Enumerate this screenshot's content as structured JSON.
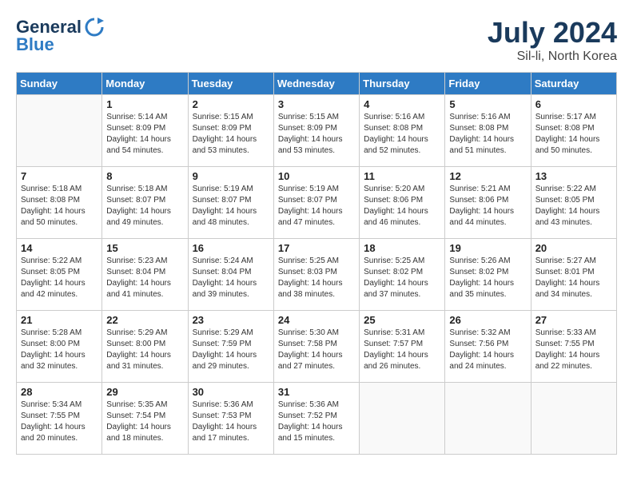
{
  "header": {
    "logo_line1": "General",
    "logo_line2": "Blue",
    "month": "July 2024",
    "location": "Sil-li, North Korea"
  },
  "weekdays": [
    "Sunday",
    "Monday",
    "Tuesday",
    "Wednesday",
    "Thursday",
    "Friday",
    "Saturday"
  ],
  "weeks": [
    [
      {
        "num": "",
        "info": ""
      },
      {
        "num": "1",
        "info": "Sunrise: 5:14 AM\nSunset: 8:09 PM\nDaylight: 14 hours\nand 54 minutes."
      },
      {
        "num": "2",
        "info": "Sunrise: 5:15 AM\nSunset: 8:09 PM\nDaylight: 14 hours\nand 53 minutes."
      },
      {
        "num": "3",
        "info": "Sunrise: 5:15 AM\nSunset: 8:09 PM\nDaylight: 14 hours\nand 53 minutes."
      },
      {
        "num": "4",
        "info": "Sunrise: 5:16 AM\nSunset: 8:08 PM\nDaylight: 14 hours\nand 52 minutes."
      },
      {
        "num": "5",
        "info": "Sunrise: 5:16 AM\nSunset: 8:08 PM\nDaylight: 14 hours\nand 51 minutes."
      },
      {
        "num": "6",
        "info": "Sunrise: 5:17 AM\nSunset: 8:08 PM\nDaylight: 14 hours\nand 50 minutes."
      }
    ],
    [
      {
        "num": "7",
        "info": "Sunrise: 5:18 AM\nSunset: 8:08 PM\nDaylight: 14 hours\nand 50 minutes."
      },
      {
        "num": "8",
        "info": "Sunrise: 5:18 AM\nSunset: 8:07 PM\nDaylight: 14 hours\nand 49 minutes."
      },
      {
        "num": "9",
        "info": "Sunrise: 5:19 AM\nSunset: 8:07 PM\nDaylight: 14 hours\nand 48 minutes."
      },
      {
        "num": "10",
        "info": "Sunrise: 5:19 AM\nSunset: 8:07 PM\nDaylight: 14 hours\nand 47 minutes."
      },
      {
        "num": "11",
        "info": "Sunrise: 5:20 AM\nSunset: 8:06 PM\nDaylight: 14 hours\nand 46 minutes."
      },
      {
        "num": "12",
        "info": "Sunrise: 5:21 AM\nSunset: 8:06 PM\nDaylight: 14 hours\nand 44 minutes."
      },
      {
        "num": "13",
        "info": "Sunrise: 5:22 AM\nSunset: 8:05 PM\nDaylight: 14 hours\nand 43 minutes."
      }
    ],
    [
      {
        "num": "14",
        "info": "Sunrise: 5:22 AM\nSunset: 8:05 PM\nDaylight: 14 hours\nand 42 minutes."
      },
      {
        "num": "15",
        "info": "Sunrise: 5:23 AM\nSunset: 8:04 PM\nDaylight: 14 hours\nand 41 minutes."
      },
      {
        "num": "16",
        "info": "Sunrise: 5:24 AM\nSunset: 8:04 PM\nDaylight: 14 hours\nand 39 minutes."
      },
      {
        "num": "17",
        "info": "Sunrise: 5:25 AM\nSunset: 8:03 PM\nDaylight: 14 hours\nand 38 minutes."
      },
      {
        "num": "18",
        "info": "Sunrise: 5:25 AM\nSunset: 8:02 PM\nDaylight: 14 hours\nand 37 minutes."
      },
      {
        "num": "19",
        "info": "Sunrise: 5:26 AM\nSunset: 8:02 PM\nDaylight: 14 hours\nand 35 minutes."
      },
      {
        "num": "20",
        "info": "Sunrise: 5:27 AM\nSunset: 8:01 PM\nDaylight: 14 hours\nand 34 minutes."
      }
    ],
    [
      {
        "num": "21",
        "info": "Sunrise: 5:28 AM\nSunset: 8:00 PM\nDaylight: 14 hours\nand 32 minutes."
      },
      {
        "num": "22",
        "info": "Sunrise: 5:29 AM\nSunset: 8:00 PM\nDaylight: 14 hours\nand 31 minutes."
      },
      {
        "num": "23",
        "info": "Sunrise: 5:29 AM\nSunset: 7:59 PM\nDaylight: 14 hours\nand 29 minutes."
      },
      {
        "num": "24",
        "info": "Sunrise: 5:30 AM\nSunset: 7:58 PM\nDaylight: 14 hours\nand 27 minutes."
      },
      {
        "num": "25",
        "info": "Sunrise: 5:31 AM\nSunset: 7:57 PM\nDaylight: 14 hours\nand 26 minutes."
      },
      {
        "num": "26",
        "info": "Sunrise: 5:32 AM\nSunset: 7:56 PM\nDaylight: 14 hours\nand 24 minutes."
      },
      {
        "num": "27",
        "info": "Sunrise: 5:33 AM\nSunset: 7:55 PM\nDaylight: 14 hours\nand 22 minutes."
      }
    ],
    [
      {
        "num": "28",
        "info": "Sunrise: 5:34 AM\nSunset: 7:55 PM\nDaylight: 14 hours\nand 20 minutes."
      },
      {
        "num": "29",
        "info": "Sunrise: 5:35 AM\nSunset: 7:54 PM\nDaylight: 14 hours\nand 18 minutes."
      },
      {
        "num": "30",
        "info": "Sunrise: 5:36 AM\nSunset: 7:53 PM\nDaylight: 14 hours\nand 17 minutes."
      },
      {
        "num": "31",
        "info": "Sunrise: 5:36 AM\nSunset: 7:52 PM\nDaylight: 14 hours\nand 15 minutes."
      },
      {
        "num": "",
        "info": ""
      },
      {
        "num": "",
        "info": ""
      },
      {
        "num": "",
        "info": ""
      }
    ]
  ]
}
